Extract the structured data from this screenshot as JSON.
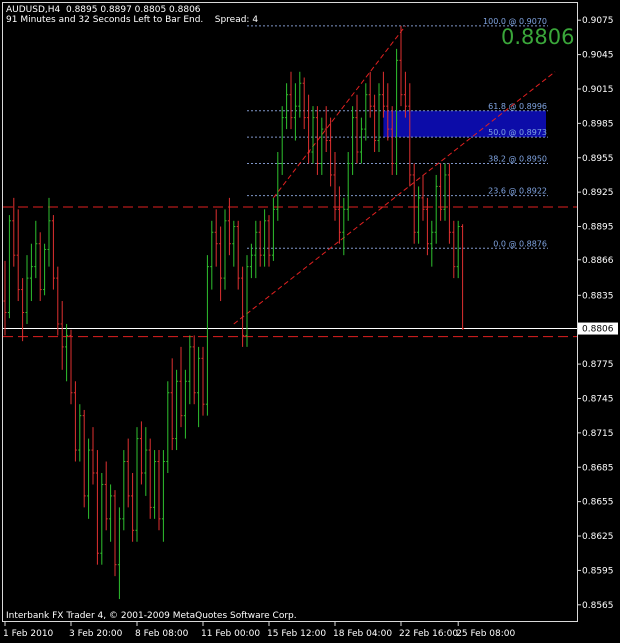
{
  "header": {
    "line1": "AUDUSD,H4  0.8895 0.8897 0.8805 0.8806",
    "line2": "91 Minutes and 32 Seconds Left to Bar End.    Spread: 4"
  },
  "big_price": "0.8806",
  "copyright": "Interbank FX Trader 4, © 2001-2009 MetaQuotes Software Corp.",
  "colors": {
    "background": "#000000",
    "bull": "#2fc12f",
    "bear": "#e03030",
    "fib": "#7f96c8",
    "fib_zone": "#0c0ca8",
    "resistance": "#e02020",
    "current_price_line": "#ffffff"
  },
  "chart_data": {
    "type": "candlestick",
    "symbol": "AUDUSD",
    "timeframe": "H4",
    "current_price": 0.8806,
    "ylim": [
      0.855,
      0.909
    ],
    "y_ticks": [
      "0.9075",
      "0.9045",
      "0.9015",
      "0.8985",
      "0.8955",
      "0.8925",
      "0.8895",
      "0.8866",
      "0.8835",
      "0.8806",
      "0.8775",
      "0.8745",
      "0.8715",
      "0.8685",
      "0.8655",
      "0.8625",
      "0.8595",
      "0.8565"
    ],
    "x_ticks": [
      "1 Feb 2010",
      "3 Feb 20:00",
      "8 Feb 08:00",
      "11 Feb 00:00",
      "15 Feb 12:00",
      "18 Feb 04:00",
      "22 Feb 16:00",
      "25 Feb 08:00"
    ],
    "x_tick_bar_index": [
      0,
      15,
      30,
      45,
      60,
      75,
      90,
      103
    ],
    "fib_levels": [
      {
        "label": "100.0 @ 0.9070",
        "value": 0.907
      },
      {
        "label": "61.8 @ 0.8996",
        "value": 0.8996
      },
      {
        "label": "50.0 @ 0.8973",
        "value": 0.8973
      },
      {
        "label": "38.2 @ 0.8950",
        "value": 0.895
      },
      {
        "label": "23.6 @ 0.8922",
        "value": 0.8922
      },
      {
        "label": "0.0 @ 0.8876",
        "value": 0.8876
      }
    ],
    "fib_start_bar": 55,
    "fib_zone": {
      "from_bar": 86,
      "high": 0.8996,
      "low": 0.8973
    },
    "horizontal_lines": [
      {
        "name": "resistance",
        "value": 0.8912,
        "style": "dashed"
      },
      {
        "name": "support",
        "value": 0.8799,
        "style": "dashed"
      },
      {
        "name": "current",
        "value": 0.8806,
        "style": "solid"
      }
    ],
    "trend_lines": [
      {
        "from_bar": 52,
        "from_value": 0.881,
        "to_bar": 125,
        "to_value": 0.903
      },
      {
        "from_bar": 61,
        "from_value": 0.892,
        "to_bar": 91,
        "to_value": 0.907
      }
    ],
    "ohlc": [
      [
        0.883,
        0.8865,
        0.88,
        0.882
      ],
      [
        0.882,
        0.8905,
        0.8815,
        0.89
      ],
      [
        0.89,
        0.892,
        0.886,
        0.887
      ],
      [
        0.887,
        0.891,
        0.883,
        0.884
      ],
      [
        0.884,
        0.885,
        0.8795,
        0.882
      ],
      [
        0.882,
        0.887,
        0.881,
        0.885
      ],
      [
        0.885,
        0.888,
        0.883,
        0.886
      ],
      [
        0.886,
        0.89,
        0.885,
        0.888
      ],
      [
        0.888,
        0.889,
        0.883,
        0.884
      ],
      [
        0.884,
        0.888,
        0.8835,
        0.8875
      ],
      [
        0.8875,
        0.892,
        0.886,
        0.89
      ],
      [
        0.89,
        0.8905,
        0.884,
        0.885
      ],
      [
        0.885,
        0.886,
        0.88,
        0.881
      ],
      [
        0.881,
        0.883,
        0.877,
        0.879
      ],
      [
        0.879,
        0.881,
        0.876,
        0.88
      ],
      [
        0.88,
        0.8805,
        0.874,
        0.875
      ],
      [
        0.875,
        0.876,
        0.869,
        0.87
      ],
      [
        0.87,
        0.874,
        0.869,
        0.873
      ],
      [
        0.873,
        0.8735,
        0.865,
        0.866
      ],
      [
        0.866,
        0.871,
        0.864,
        0.87
      ],
      [
        0.87,
        0.872,
        0.867,
        0.868
      ],
      [
        0.868,
        0.87,
        0.86,
        0.861
      ],
      [
        0.861,
        0.868,
        0.86,
        0.867
      ],
      [
        0.867,
        0.869,
        0.863,
        0.864
      ],
      [
        0.864,
        0.867,
        0.862,
        0.866
      ],
      [
        0.866,
        0.8665,
        0.859,
        0.86
      ],
      [
        0.86,
        0.865,
        0.857,
        0.864
      ],
      [
        0.864,
        0.87,
        0.863,
        0.869
      ],
      [
        0.869,
        0.871,
        0.865,
        0.866
      ],
      [
        0.866,
        0.868,
        0.862,
        0.863
      ],
      [
        0.863,
        0.872,
        0.862,
        0.871
      ],
      [
        0.871,
        0.8725,
        0.867,
        0.868
      ],
      [
        0.868,
        0.872,
        0.866,
        0.87
      ],
      [
        0.87,
        0.871,
        0.864,
        0.865
      ],
      [
        0.865,
        0.87,
        0.864,
        0.869
      ],
      [
        0.869,
        0.87,
        0.863,
        0.864
      ],
      [
        0.864,
        0.87,
        0.862,
        0.869
      ],
      [
        0.869,
        0.876,
        0.868,
        0.875
      ],
      [
        0.875,
        0.878,
        0.87,
        0.871
      ],
      [
        0.871,
        0.877,
        0.87,
        0.876
      ],
      [
        0.876,
        0.879,
        0.872,
        0.873
      ],
      [
        0.873,
        0.877,
        0.871,
        0.876
      ],
      [
        0.876,
        0.88,
        0.874,
        0.879
      ],
      [
        0.879,
        0.88,
        0.874,
        0.875
      ],
      [
        0.875,
        0.879,
        0.872,
        0.878
      ],
      [
        0.878,
        0.879,
        0.873,
        0.874
      ],
      [
        0.874,
        0.887,
        0.873,
        0.886
      ],
      [
        0.886,
        0.89,
        0.884,
        0.889
      ],
      [
        0.889,
        0.891,
        0.886,
        0.888
      ],
      [
        0.888,
        0.8895,
        0.883,
        0.885
      ],
      [
        0.885,
        0.891,
        0.884,
        0.89
      ],
      [
        0.89,
        0.892,
        0.887,
        0.888
      ],
      [
        0.888,
        0.89,
        0.886,
        0.8895
      ],
      [
        0.8895,
        0.89,
        0.884,
        0.885
      ],
      [
        0.885,
        0.886,
        0.879,
        0.88
      ],
      [
        0.88,
        0.887,
        0.879,
        0.886
      ],
      [
        0.886,
        0.888,
        0.885,
        0.887
      ],
      [
        0.887,
        0.89,
        0.885,
        0.889
      ],
      [
        0.889,
        0.89,
        0.886,
        0.887
      ],
      [
        0.887,
        0.891,
        0.886,
        0.89
      ],
      [
        0.89,
        0.8905,
        0.886,
        0.887
      ],
      [
        0.887,
        0.892,
        0.8865,
        0.891
      ],
      [
        0.891,
        0.896,
        0.89,
        0.895
      ],
      [
        0.895,
        0.9,
        0.894,
        0.899
      ],
      [
        0.899,
        0.902,
        0.898,
        0.901
      ],
      [
        0.901,
        0.903,
        0.898,
        0.899
      ],
      [
        0.899,
        0.902,
        0.897,
        0.9
      ],
      [
        0.9,
        0.903,
        0.899,
        0.902
      ],
      [
        0.902,
        0.9025,
        0.898,
        0.899
      ],
      [
        0.899,
        0.901,
        0.895,
        0.896
      ],
      [
        0.896,
        0.9,
        0.895,
        0.899
      ],
      [
        0.899,
        0.9,
        0.894,
        0.895
      ],
      [
        0.895,
        0.899,
        0.894,
        0.898
      ],
      [
        0.898,
        0.9,
        0.896,
        0.897
      ],
      [
        0.897,
        0.899,
        0.893,
        0.894
      ],
      [
        0.894,
        0.896,
        0.89,
        0.891
      ],
      [
        0.891,
        0.893,
        0.888,
        0.889
      ],
      [
        0.889,
        0.892,
        0.887,
        0.891
      ],
      [
        0.891,
        0.896,
        0.89,
        0.895
      ],
      [
        0.895,
        0.9,
        0.894,
        0.899
      ],
      [
        0.899,
        0.901,
        0.895,
        0.896
      ],
      [
        0.896,
        0.899,
        0.895,
        0.898
      ],
      [
        0.898,
        0.902,
        0.897,
        0.901
      ],
      [
        0.901,
        0.903,
        0.899,
        0.9
      ],
      [
        0.9,
        0.901,
        0.896,
        0.897
      ],
      [
        0.897,
        0.902,
        0.896,
        0.901
      ],
      [
        0.901,
        0.903,
        0.899,
        0.9
      ],
      [
        0.9,
        0.902,
        0.897,
        0.898
      ],
      [
        0.898,
        0.9,
        0.894,
        0.895
      ],
      [
        0.895,
        0.905,
        0.894,
        0.904
      ],
      [
        0.904,
        0.907,
        0.9,
        0.901
      ],
      [
        0.901,
        0.903,
        0.899,
        0.9
      ],
      [
        0.9,
        0.902,
        0.893,
        0.894
      ],
      [
        0.894,
        0.895,
        0.888,
        0.889
      ],
      [
        0.889,
        0.893,
        0.888,
        0.892
      ],
      [
        0.892,
        0.894,
        0.89,
        0.891
      ],
      [
        0.891,
        0.892,
        0.887,
        0.888
      ],
      [
        0.888,
        0.89,
        0.886,
        0.889
      ],
      [
        0.889,
        0.894,
        0.888,
        0.893
      ],
      [
        0.893,
        0.895,
        0.89,
        0.891
      ],
      [
        0.891,
        0.895,
        0.89,
        0.894
      ],
      [
        0.894,
        0.895,
        0.888,
        0.889
      ],
      [
        0.889,
        0.89,
        0.885,
        0.886
      ],
      [
        0.886,
        0.89,
        0.885,
        0.8895
      ],
      [
        0.8895,
        0.8897,
        0.8805,
        0.8806
      ]
    ]
  }
}
